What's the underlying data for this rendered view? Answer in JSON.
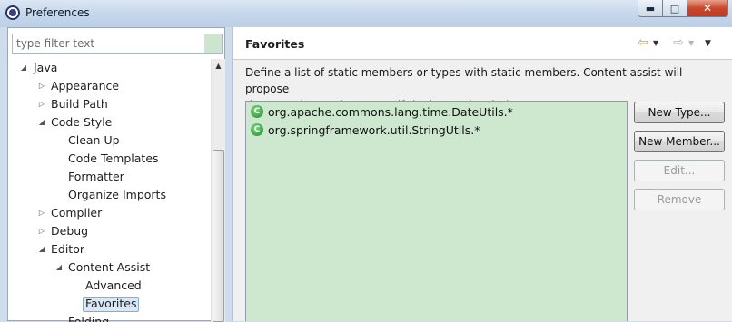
{
  "window": {
    "title": "Preferences",
    "controls": {
      "minimize": "▬",
      "maximize": "□",
      "close": "✕"
    }
  },
  "filter": {
    "placeholder": "type filter text",
    "value": ""
  },
  "tree": {
    "items": [
      {
        "label": "Java",
        "depth": 0,
        "state": "expanded"
      },
      {
        "label": "Appearance",
        "depth": 1,
        "state": "collapsed"
      },
      {
        "label": "Build Path",
        "depth": 1,
        "state": "collapsed"
      },
      {
        "label": "Code Style",
        "depth": 1,
        "state": "expanded"
      },
      {
        "label": "Clean Up",
        "depth": 2,
        "state": "leaf"
      },
      {
        "label": "Code Templates",
        "depth": 2,
        "state": "leaf"
      },
      {
        "label": "Formatter",
        "depth": 2,
        "state": "leaf"
      },
      {
        "label": "Organize Imports",
        "depth": 2,
        "state": "leaf"
      },
      {
        "label": "Compiler",
        "depth": 1,
        "state": "collapsed"
      },
      {
        "label": "Debug",
        "depth": 1,
        "state": "collapsed"
      },
      {
        "label": "Editor",
        "depth": 1,
        "state": "expanded"
      },
      {
        "label": "Content Assist",
        "depth": 2,
        "state": "expanded"
      },
      {
        "label": "Advanced",
        "depth": 3,
        "state": "leaf"
      },
      {
        "label": "Favorites",
        "depth": 3,
        "state": "leaf",
        "selected": true
      },
      {
        "label": "Folding",
        "depth": 2,
        "state": "leaf"
      }
    ]
  },
  "page": {
    "title": "Favorites",
    "description_line1": "Define a list of static members or types with static members. Content assist will propose",
    "description_line2": "those static members even if the import is missing.",
    "favorites": [
      "org.apache.commons.lang.time.DateUtils.*",
      "org.springframework.util.StringUtils.*"
    ],
    "buttons": {
      "new_type": "New Type...",
      "new_member": "New Member...",
      "edit": "Edit...",
      "remove": "Remove"
    }
  },
  "icons": {
    "nav_back": "arrow-left-icon",
    "nav_forward": "arrow-right-icon",
    "view_menu": "chevron-down-icon",
    "favorite_item": "static-member-icon"
  },
  "colors": {
    "list_background": "#cde8cf",
    "selection": "#d9e8f7",
    "back_arrow": "#d9a520"
  }
}
